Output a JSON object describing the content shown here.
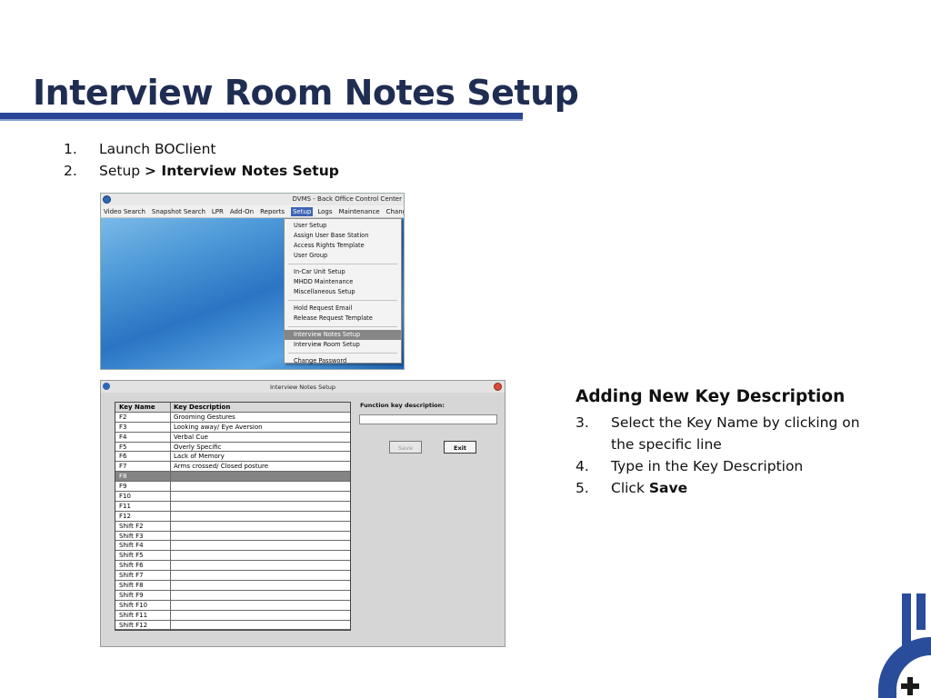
{
  "slide": {
    "title": "Interview Room Notes Setup"
  },
  "steps": [
    {
      "num": "1.",
      "text": "Launch BOClient",
      "bold": ""
    },
    {
      "num": "2.",
      "text": "Setup ",
      "bold": "> Interview Notes Setup"
    }
  ],
  "screenshot_menu": {
    "window_title": "DVMS - Back Office Control Center",
    "menubar": [
      "Video Search",
      "Snapshot Search",
      "LPR",
      "Add-On",
      "Reports",
      "Setup",
      "Logs",
      "Maintenance",
      "Change Se"
    ],
    "active_menu": "Setup",
    "dropdown_groups": [
      [
        "User Setup",
        "Assign User Base Station",
        "Access Rights Template",
        "User Group"
      ],
      [
        "In-Car Unit Setup",
        "MHDD Maintenance",
        "Miscellaneous Setup"
      ],
      [
        "Hold Request Email",
        "Release Request Template"
      ],
      [
        "Interview Notes Setup",
        "Interview Room Setup"
      ],
      [
        "Change Password"
      ]
    ],
    "selected_item": "Interview Notes Setup"
  },
  "screenshot_dialog": {
    "title": "Interview Notes Setup",
    "columns": [
      "Key Name",
      "Key Description"
    ],
    "rows": [
      [
        "F2",
        "Grooming Gestures"
      ],
      [
        "F3",
        "Looking away/ Eye Aversion"
      ],
      [
        "F4",
        "Verbal Cue"
      ],
      [
        "F5",
        "Overly Specific"
      ],
      [
        "F6",
        "Lack of Memory"
      ],
      [
        "F7",
        "Arms crossed/ Closed posture"
      ],
      [
        "F8",
        ""
      ],
      [
        "F9",
        ""
      ],
      [
        "F10",
        ""
      ],
      [
        "F11",
        ""
      ],
      [
        "F12",
        ""
      ],
      [
        "Shift F2",
        ""
      ],
      [
        "Shift F3",
        ""
      ],
      [
        "Shift F4",
        ""
      ],
      [
        "Shift F5",
        ""
      ],
      [
        "Shift F6",
        ""
      ],
      [
        "Shift F7",
        ""
      ],
      [
        "Shift F8",
        ""
      ],
      [
        "Shift F9",
        ""
      ],
      [
        "Shift F10",
        ""
      ],
      [
        "Shift F11",
        ""
      ],
      [
        "Shift F12",
        ""
      ]
    ],
    "selected_row": "F8",
    "function_key_label": "Function key description:",
    "function_key_value": "",
    "save_label": "Save",
    "exit_label": "Exit"
  },
  "adding": {
    "heading": "Adding New Key Description",
    "steps": [
      {
        "num": "3.",
        "text": "Select the Key Name by clicking on the specific line",
        "bold": ""
      },
      {
        "num": "4.",
        "text": "Type in the Key Description",
        "bold": ""
      },
      {
        "num": "5.",
        "text": "Click ",
        "bold": "Save"
      }
    ]
  },
  "colors": {
    "title_text": "#1f2d52",
    "rule": "#2a4496",
    "logo_blue": "#2a4d9b",
    "logo_dark": "#1a1a1a"
  },
  "icons": [
    "app-icon",
    "close-icon",
    "logo-mark"
  ]
}
